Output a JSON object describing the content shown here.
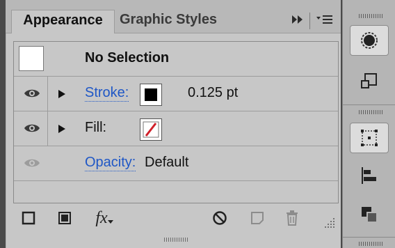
{
  "tabs": [
    {
      "label": "Appearance",
      "active": true
    },
    {
      "label": "Graphic Styles",
      "active": false
    }
  ],
  "header_icons": [
    "double-chevron-right-icon",
    "panel-menu-icon"
  ],
  "appearance": {
    "header_label": "No Selection",
    "rows": [
      {
        "label": "Stroke:",
        "link": true,
        "value": "0.125 pt",
        "swatch": "black"
      },
      {
        "label": "Fill:",
        "link": false,
        "swatch": "none-red-slash"
      },
      {
        "label": "Opacity:",
        "link": true,
        "value": "Default"
      }
    ]
  },
  "bottom_toolbar": {
    "fx_label": "fx",
    "icons": [
      "add-stroke-icon",
      "add-fill-icon",
      "fx-icon",
      "clear-appearance-icon",
      "duplicate-item-icon",
      "trash-icon"
    ]
  },
  "colors": {
    "link": "#1f57c6",
    "fill_slash": "#d0202a",
    "panel_bg": "#c7c7c7"
  },
  "dock_icons": [
    "appearance-icon",
    "graphic-styles-icon",
    "transform-icon",
    "align-icon",
    "pathfinder-icon"
  ]
}
